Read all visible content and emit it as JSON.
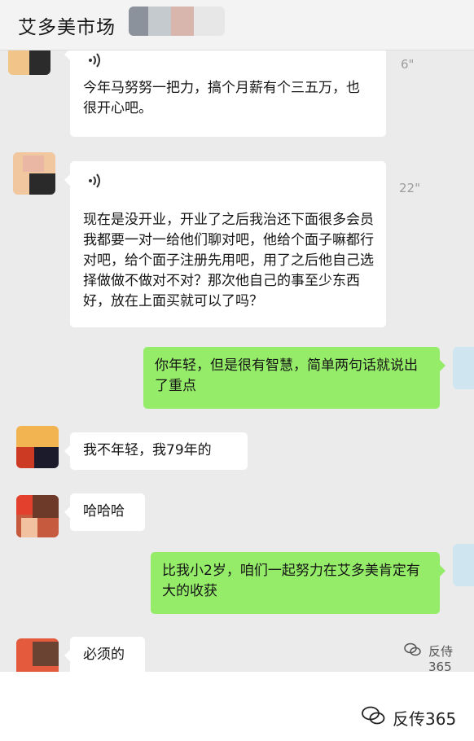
{
  "header": {
    "title": "艾多美市场"
  },
  "messages": [
    {
      "side": "in",
      "type": "voice",
      "duration": "6\"",
      "transcript": "今年马努努一把力，搞个月薪有个三五万，也很开心吧。"
    },
    {
      "side": "in",
      "type": "voice",
      "duration": "22\"",
      "transcript": "现在是没开业，开业了之后我治还下面很多会员我都要一对一给他们聊对吧，他给个面子嘛都行对吧，给个面子注册先用吧，用了之后他自己选择做做不做对不对？那次他自己的事至少东西好，放在上面买就可以了吗？"
    },
    {
      "side": "out",
      "type": "text",
      "text": "你年轻，但是很有智慧，简单两句话就说出了重点"
    },
    {
      "side": "in",
      "type": "text",
      "text": "我不年轻，我79年的"
    },
    {
      "side": "in",
      "type": "text",
      "text": "哈哈哈"
    },
    {
      "side": "out",
      "type": "text",
      "text": "比我小2岁，咱们一起努力在艾多美肯定有大的收获"
    },
    {
      "side": "in",
      "type": "text",
      "text": "必须的"
    }
  ],
  "watermark": {
    "small": "反侍365",
    "large": "反传365"
  },
  "colors": {
    "incoming_bubble": "#ffffff",
    "outgoing_bubble": "#95ec69",
    "chat_background": "#ebebeb",
    "header_background": "#f3f3f3"
  },
  "icons": {
    "voice": "voice-wave-icon",
    "watermark": "wechat-watermark-icon"
  }
}
